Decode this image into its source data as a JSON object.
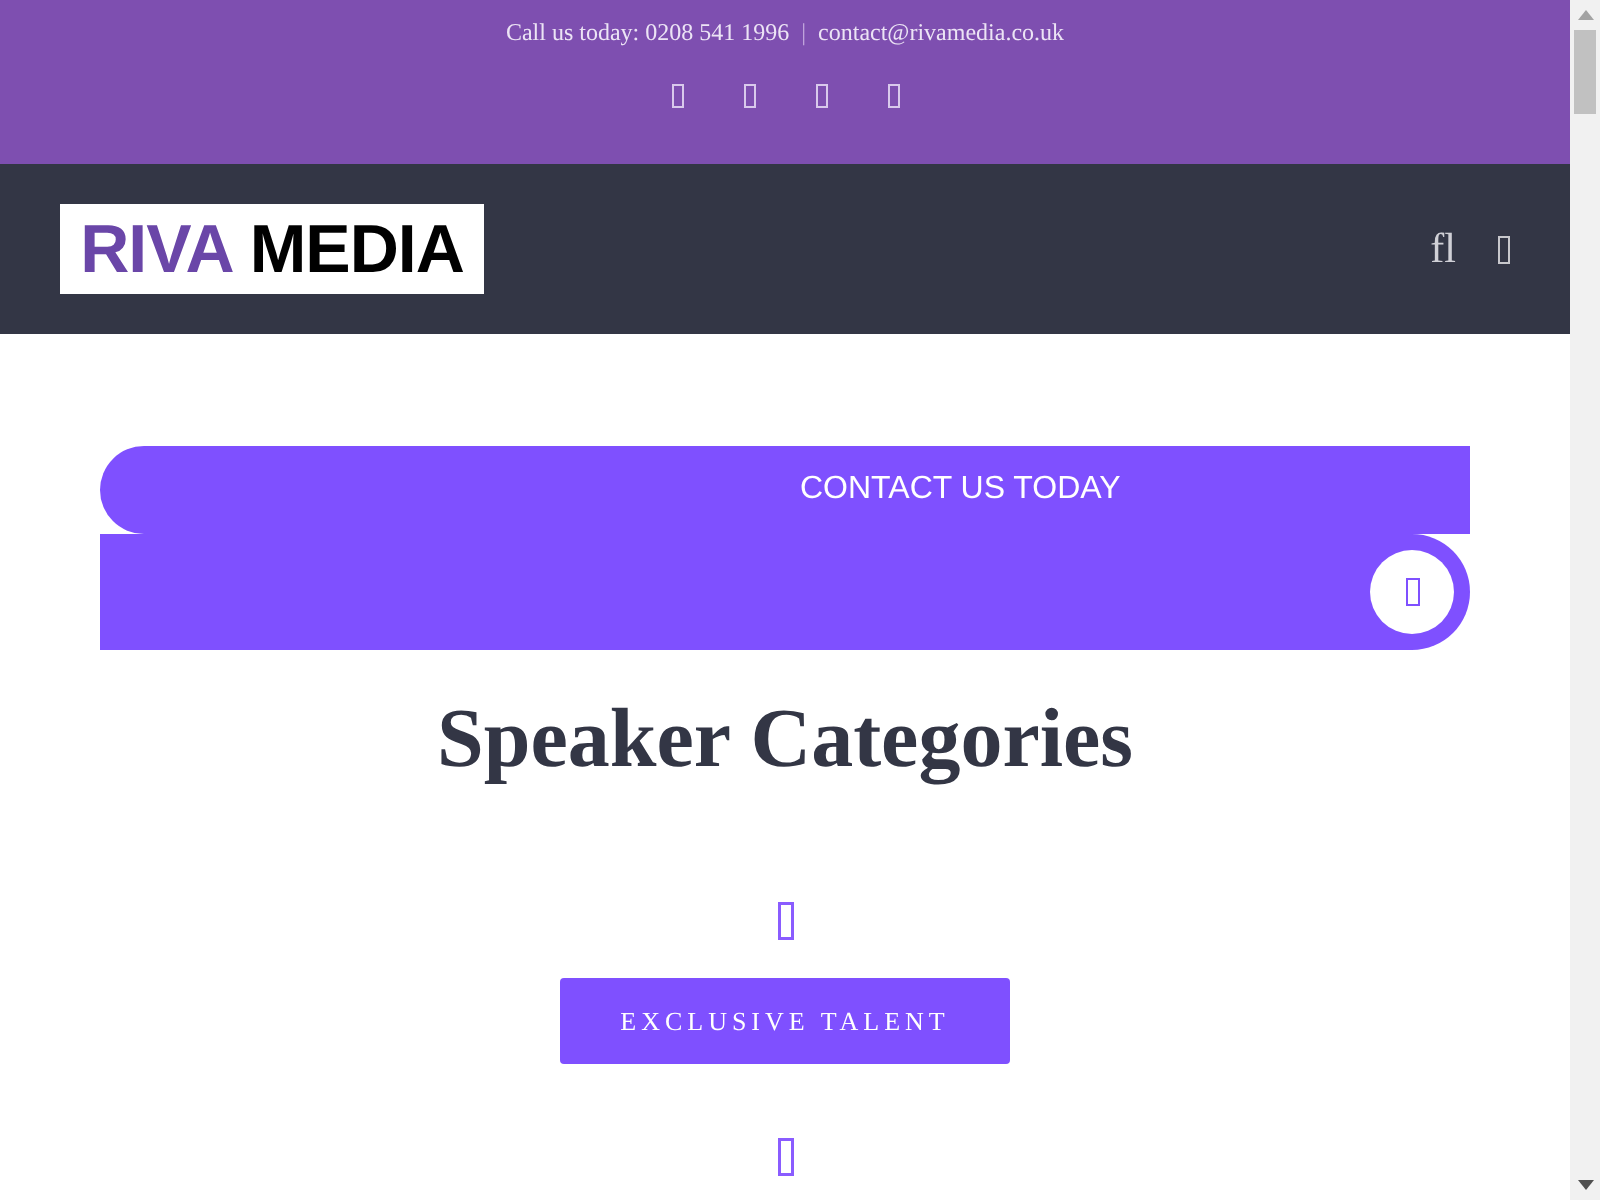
{
  "top_bar": {
    "phone_text": "Call us today: 0208 541 1996",
    "separator": "|",
    "email": "contact@rivamedia.co.uk"
  },
  "header": {
    "logo": {
      "word_1": "RIVA",
      "word_2": "MEDIA"
    },
    "search_glyph": "fl"
  },
  "banner": {
    "label": "CONTACT US TODAY"
  },
  "heading": "Speaker Categories",
  "categories": [
    {
      "label": "EXCLUSIVE TALENT"
    }
  ]
}
